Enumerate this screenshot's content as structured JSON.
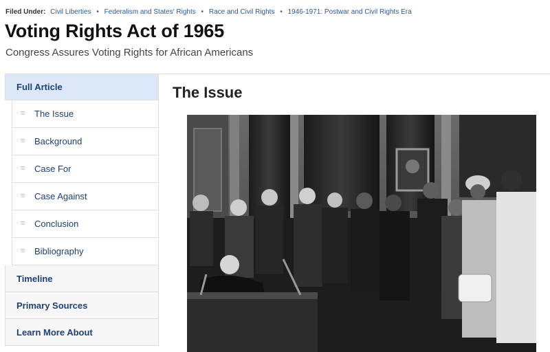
{
  "filed_under": {
    "label": "Filed Under:",
    "topics": [
      "Civil Liberties",
      "Federalism and States' Rights",
      "Race and Civil Rights",
      "1946-1971: Postwar and Civil Rights Era"
    ],
    "separator": "•"
  },
  "article": {
    "title": "Voting Rights Act of 1965",
    "subtitle": "Congress Assures Voting Rights for African Americans"
  },
  "sidebar": {
    "full_article": "Full Article",
    "subitems": [
      "The Issue",
      "Background",
      "Case For",
      "Case Against",
      "Conclusion",
      "Bibliography"
    ],
    "timeline": "Timeline",
    "primary_sources": "Primary Sources",
    "learn_more": "Learn More About"
  },
  "main": {
    "section_title": "The Issue",
    "image_alt": "President signing the Voting Rights Act surrounded by civil rights leaders"
  },
  "icons": {
    "subitem": "menu-lines-icon"
  },
  "colors": {
    "link": "#1d3f73",
    "active_bg": "#dce8f7"
  }
}
